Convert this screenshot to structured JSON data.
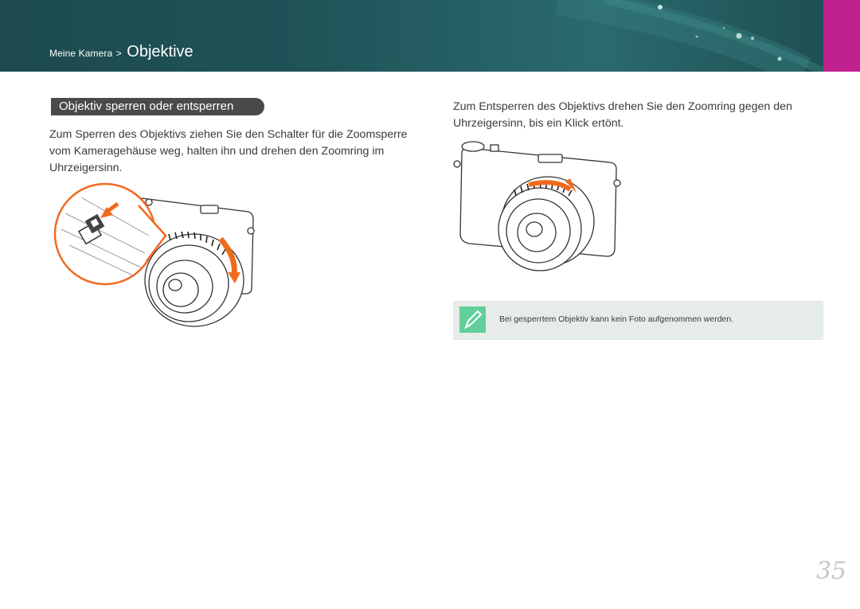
{
  "header": {
    "breadcrumb_parent": "Meine Kamera",
    "breadcrumb_separator": ">",
    "breadcrumb_current": "Objektive",
    "background_color": "#1f5358",
    "tab_color": "#c0218f"
  },
  "section": {
    "title": "Objektiv sperren oder entsperren"
  },
  "left_column": {
    "text": "Zum Sperren des Objektivs ziehen Sie den Schalter für die Zoomsperre vom Kameragehäuse weg, halten ihn und drehen den Zoomring im Uhrzeigersinn."
  },
  "right_column": {
    "text": "Zum Entsperren des Objektivs drehen Sie den Zoomring gegen den Uhrzeigersinn, bis ein Klick ertönt."
  },
  "note": {
    "icon": "pencil-note-icon",
    "text": "Bei gesperrtem Objektiv kann kein Foto aufgenommen werden.",
    "accent_color": "#62cf9b"
  },
  "page": {
    "number": "35"
  },
  "accent_arrow_color": "#f06a1e"
}
